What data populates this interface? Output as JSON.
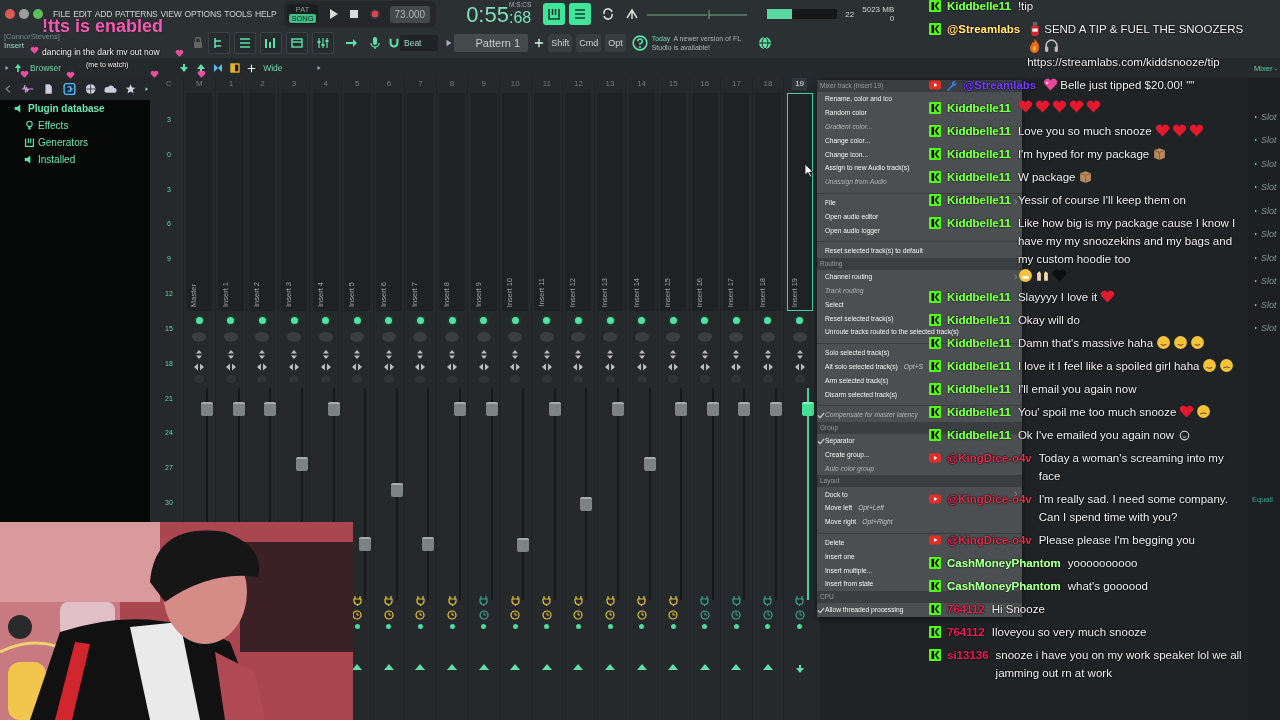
{
  "menu_bar": [
    "FILE",
    "EDIT",
    "ADD",
    "PATTERNS",
    "VIEW",
    "OPTIONS",
    "TOOLS",
    "HELP"
  ],
  "transport": {
    "modes": [
      {
        "label": "PAT",
        "selected": false
      },
      {
        "label": "SONG",
        "selected": true
      }
    ],
    "tempo": "73.000",
    "time": "0:55",
    "time_fraction": ":68",
    "time_unit": "M:S:CS"
  },
  "cpu_meter": {
    "level": 0.35
  },
  "cpu": "22",
  "memory": "5023 MB",
  "polyphony": "0",
  "toolbar": {
    "user_tag": "[ConnorStevens]",
    "track_label": "Insert",
    "snap": "Beat",
    "pattern": "Pattern 1",
    "modifiers": [
      "Shift",
      "Cmd",
      "Opt"
    ],
    "news_date": "Today",
    "news": "A newer version of FL Studio is available!"
  },
  "browser_bar": {
    "title": "Browser",
    "view": "Wide",
    "mixer_title": "Mixer -"
  },
  "browser": {
    "tree": [
      {
        "label": "Plugin database",
        "kind": "database",
        "children": [
          {
            "label": "Effects",
            "kind": "effects"
          },
          {
            "label": "Generators",
            "kind": "generators"
          },
          {
            "label": "Installed",
            "kind": "installed"
          }
        ]
      }
    ]
  },
  "mixer": {
    "scale_header": "C",
    "scale": [
      "3",
      "0",
      "3",
      "6",
      "9",
      "12",
      "15",
      "18",
      "21",
      "24",
      "27",
      "30"
    ],
    "tracks": [
      {
        "number": "M",
        "name": "Master",
        "level": 0.93,
        "selected": false
      },
      {
        "number": "1",
        "name": "Insert 1",
        "level": 0.93,
        "selected": false
      },
      {
        "number": "2",
        "name": "Insert 2",
        "level": 0.93,
        "selected": false
      },
      {
        "number": "3",
        "name": "Insert 3",
        "level": 0.65,
        "selected": false
      },
      {
        "number": "4",
        "name": "Insert 4",
        "level": 0.93,
        "selected": false
      },
      {
        "number": "5",
        "name": "Insert 5",
        "level": 0.25,
        "selected": false,
        "fx": true
      },
      {
        "number": "6",
        "name": "Insert 6",
        "level": 0.52,
        "selected": false,
        "fx": true
      },
      {
        "number": "7",
        "name": "Insert 7",
        "level": 0.25,
        "selected": false,
        "fx": true
      },
      {
        "number": "8",
        "name": "Insert 8",
        "level": 0.93,
        "selected": false,
        "fx": true
      },
      {
        "number": "9",
        "name": "Insert 9",
        "level": 0.93,
        "selected": false,
        "fx": false
      },
      {
        "number": "10",
        "name": "Insert 10",
        "level": 0.24,
        "selected": false,
        "fx": true
      },
      {
        "number": "11",
        "name": "Insert 11",
        "level": 0.93,
        "selected": false,
        "fx": true
      },
      {
        "number": "12",
        "name": "Insert 12",
        "level": 0.45,
        "selected": false,
        "fx": true
      },
      {
        "number": "13",
        "name": "Insert 13",
        "level": 0.93,
        "selected": false,
        "fx": true
      },
      {
        "number": "14",
        "name": "Insert 14",
        "level": 0.65,
        "selected": false,
        "fx": true
      },
      {
        "number": "15",
        "name": "Insert 15",
        "level": 0.93,
        "selected": false,
        "fx": true
      },
      {
        "number": "16",
        "name": "Insert 16",
        "level": 0.93,
        "selected": false,
        "fx": false
      },
      {
        "number": "17",
        "name": "Insert 17",
        "level": 0.93,
        "selected": false,
        "fx": false
      },
      {
        "number": "18",
        "name": "Insert 18",
        "level": 0.93,
        "selected": false,
        "fx": false
      },
      {
        "number": "19",
        "name": "Insert 19",
        "level": 0.93,
        "selected": true,
        "fx": false
      }
    ]
  },
  "right_panel": {
    "slots": [
      "Slot",
      "Slot",
      "Slot",
      "Slot",
      "Slot",
      "Slot",
      "Slot",
      "Slot",
      "Slot",
      "Slot"
    ],
    "label": "Equali"
  },
  "context_menu": {
    "title": "Mixer track (Insert 19)",
    "items": [
      {
        "kind": "item",
        "label": "Rename, color and ico",
        "disabled": false,
        "checked": false,
        "submenu": false
      },
      {
        "kind": "item",
        "label": "Random color",
        "disabled": false,
        "checked": false,
        "submenu": false
      },
      {
        "kind": "item",
        "label": "Gradient color...",
        "disabled": true,
        "checked": false,
        "submenu": false
      },
      {
        "kind": "item",
        "label": "Change color...",
        "disabled": false,
        "checked": false,
        "submenu": false
      },
      {
        "kind": "item",
        "label": "Change icon...",
        "disabled": false,
        "checked": false,
        "submenu": false
      },
      {
        "kind": "item",
        "label": "Assign to new Audio track(s)",
        "disabled": false,
        "checked": false,
        "submenu": false
      },
      {
        "kind": "item",
        "label": "Unassign from Audio",
        "disabled": true,
        "checked": false,
        "submenu": false
      },
      {
        "kind": "separator"
      },
      {
        "kind": "item",
        "label": "File",
        "disabled": false,
        "checked": false,
        "submenu": true
      },
      {
        "kind": "item",
        "label": "Open audio editor",
        "disabled": false,
        "checked": false,
        "submenu": false
      },
      {
        "kind": "item",
        "label": "Open audio logger",
        "disabled": false,
        "checked": false,
        "submenu": false
      },
      {
        "kind": "separator"
      },
      {
        "kind": "item",
        "label": "Reset selected track(s) to default",
        "disabled": false,
        "checked": false,
        "submenu": false
      },
      {
        "kind": "header",
        "label": "Routing"
      },
      {
        "kind": "item",
        "label": "Channel routing",
        "disabled": false,
        "checked": false,
        "submenu": true
      },
      {
        "kind": "item",
        "label": "Track routing",
        "disabled": true,
        "checked": false,
        "submenu": false
      },
      {
        "kind": "item",
        "label": "Select",
        "disabled": false,
        "checked": false,
        "submenu": false
      },
      {
        "kind": "item",
        "label": "Reset selected track(s)",
        "disabled": false,
        "checked": false,
        "submenu": false
      },
      {
        "kind": "item",
        "label": "Unroute tracks routed to the selected track(s)",
        "disabled": false,
        "checked": false,
        "submenu": false
      },
      {
        "kind": "separator"
      },
      {
        "kind": "item",
        "label": "Solo selected track(s)",
        "disabled": false,
        "checked": false,
        "submenu": false
      },
      {
        "kind": "item",
        "label": "Alt solo selected track(s)",
        "disabled": false,
        "checked": false,
        "submenu": false,
        "shortcut": "Opt+S"
      },
      {
        "kind": "item",
        "label": "Arm selected track(s)",
        "disabled": false,
        "checked": false,
        "submenu": false
      },
      {
        "kind": "item",
        "label": "Disarm selected track(s)",
        "disabled": false,
        "checked": false,
        "submenu": false
      },
      {
        "kind": "separator"
      },
      {
        "kind": "item",
        "label": "Compensate for master latency",
        "disabled": true,
        "checked": true,
        "submenu": false
      },
      {
        "kind": "header",
        "label": "Group"
      },
      {
        "kind": "item",
        "label": "Separator",
        "disabled": false,
        "checked": true,
        "submenu": false
      },
      {
        "kind": "item",
        "label": "Create group...",
        "disabled": false,
        "checked": false,
        "submenu": false
      },
      {
        "kind": "item",
        "label": "Auto color group",
        "disabled": true,
        "checked": false,
        "submenu": false
      },
      {
        "kind": "header",
        "label": "Layout"
      },
      {
        "kind": "item",
        "label": "Dock to",
        "disabled": false,
        "checked": false,
        "submenu": true
      },
      {
        "kind": "item",
        "label": "Move left",
        "disabled": false,
        "checked": false,
        "submenu": false,
        "shortcut": "Opt+Left"
      },
      {
        "kind": "item",
        "label": "Move right",
        "disabled": false,
        "checked": false,
        "submenu": false,
        "shortcut": "Opt+Right"
      },
      {
        "kind": "separator"
      },
      {
        "kind": "item",
        "label": "Delete",
        "disabled": false,
        "checked": false,
        "submenu": false
      },
      {
        "kind": "item",
        "label": "Insert one",
        "disabled": false,
        "checked": false,
        "submenu": false
      },
      {
        "kind": "item",
        "label": "Insert multiple...",
        "disabled": false,
        "checked": false,
        "submenu": false
      },
      {
        "kind": "item",
        "label": "Insert from state",
        "disabled": false,
        "checked": false,
        "submenu": false
      },
      {
        "kind": "header",
        "label": "CPU"
      },
      {
        "kind": "item",
        "label": "Allow threaded processing",
        "disabled": false,
        "checked": true,
        "submenu": false
      }
    ]
  },
  "stream_overlay": {
    "alert": "!tts is enabled",
    "now_playing": "dancing in the dark mv out now",
    "note": "(me to watch)"
  },
  "chat": [
    {
      "badges": [
        {
          "kind": "kick"
        }
      ],
      "user": "Kiddbelle11",
      "color": "#62ec3a",
      "content": [
        {
          "kind": "text",
          "text": "!tip"
        }
      ]
    },
    {
      "badges": [
        {
          "kind": "kick"
        }
      ],
      "user": "@Streamlabs",
      "color": "#e6b45a",
      "content": [
        {
          "kind": "extinguisher"
        },
        {
          "kind": "text",
          "text": "SEND A TIP & FUEL THE SNOOZERS"
        },
        {
          "kind": "fire"
        },
        {
          "kind": "headphones"
        },
        {
          "kind": "text",
          "text": "https://streamlabs.com/kiddsnooze/tip"
        }
      ]
    },
    {
      "badges": [
        {
          "kind": "youtube"
        },
        {
          "kind": "wrench"
        }
      ],
      "user": "@Streamlabs",
      "color": "#5a2fd0",
      "content": [
        {
          "kind": "sparkle_heart"
        },
        {
          "kind": "text",
          "text": "Belle just tipped $20.00! \"\""
        }
      ]
    },
    {
      "badges": [
        {
          "kind": "kick"
        }
      ],
      "user": "Kiddbelle11",
      "color": "#62ec3a",
      "content": [
        {
          "kind": "heart"
        },
        {
          "kind": "heart"
        },
        {
          "kind": "heart"
        },
        {
          "kind": "heart"
        },
        {
          "kind": "heart"
        }
      ]
    },
    {
      "badges": [
        {
          "kind": "kick"
        }
      ],
      "user": "Kiddbelle11",
      "color": "#62ec3a",
      "content": [
        {
          "kind": "text",
          "text": "Love you so much snooze"
        },
        {
          "kind": "heart"
        },
        {
          "kind": "heart"
        },
        {
          "kind": "heart"
        }
      ]
    },
    {
      "badges": [
        {
          "kind": "kick"
        }
      ],
      "user": "Kiddbelle11",
      "color": "#62ec3a",
      "content": [
        {
          "kind": "text",
          "text": "I'm hyped for my package"
        },
        {
          "kind": "package"
        }
      ]
    },
    {
      "badges": [
        {
          "kind": "kick"
        }
      ],
      "user": "Kiddbelle11",
      "color": "#62ec3a",
      "content": [
        {
          "kind": "text",
          "text": "W package"
        },
        {
          "kind": "package"
        }
      ]
    },
    {
      "badges": [
        {
          "kind": "kick"
        }
      ],
      "user": "Kiddbelle11",
      "color": "#62ec3a",
      "content": [
        {
          "kind": "text",
          "text": "Yessir of course I'll keep them on"
        }
      ]
    },
    {
      "badges": [
        {
          "kind": "kick"
        }
      ],
      "user": "Kiddbelle11",
      "color": "#62ec3a",
      "content": [
        {
          "kind": "text",
          "text": "Like how big is my package cause I know I have my my snoozekins and my bags and my custom hoodie too"
        },
        {
          "kind": "grin"
        },
        {
          "kind": "raised_hands"
        },
        {
          "kind": "black_heart"
        }
      ]
    },
    {
      "badges": [
        {
          "kind": "kick"
        }
      ],
      "user": "Kiddbelle11",
      "color": "#62ec3a",
      "content": [
        {
          "kind": "text",
          "text": "Slayyyy I love it"
        },
        {
          "kind": "heart"
        }
      ]
    },
    {
      "badges": [
        {
          "kind": "kick"
        }
      ],
      "user": "Kiddbelle11",
      "color": "#62ec3a",
      "content": [
        {
          "kind": "text",
          "text": "Okay will do"
        }
      ]
    },
    {
      "badges": [
        {
          "kind": "kick"
        }
      ],
      "user": "Kiddbelle11",
      "color": "#62ec3a",
      "content": [
        {
          "kind": "text",
          "text": "Damn that's massive haha"
        },
        {
          "kind": "smile"
        },
        {
          "kind": "smile"
        },
        {
          "kind": "smile"
        }
      ]
    },
    {
      "badges": [
        {
          "kind": "kick"
        }
      ],
      "user": "Kiddbelle11",
      "color": "#62ec3a",
      "content": [
        {
          "kind": "text",
          "text": "I love it I feel like a spoiled girl haha"
        },
        {
          "kind": "smile"
        },
        {
          "kind": "woozy"
        }
      ]
    },
    {
      "badges": [
        {
          "kind": "kick"
        }
      ],
      "user": "Kiddbelle11",
      "color": "#62ec3a",
      "content": [
        {
          "kind": "text",
          "text": "I'll email you again now"
        }
      ]
    },
    {
      "badges": [
        {
          "kind": "kick"
        }
      ],
      "user": "Kiddbelle11",
      "color": "#62ec3a",
      "content": [
        {
          "kind": "text",
          "text": "You' spoil me too much snooze"
        },
        {
          "kind": "heart"
        },
        {
          "kind": "woozy"
        }
      ]
    },
    {
      "badges": [
        {
          "kind": "kick"
        }
      ],
      "user": "Kiddbelle11",
      "color": "#62ec3a",
      "content": [
        {
          "kind": "text",
          "text": "Ok I've emailed you again now"
        },
        {
          "kind": "small_smile"
        }
      ]
    },
    {
      "badges": [
        {
          "kind": "youtube"
        }
      ],
      "user": "@KingDice-o4v",
      "color": "#a3243a",
      "content": [
        {
          "kind": "text",
          "text": "Today a woman's screaming into my face"
        }
      ]
    },
    {
      "badges": [
        {
          "kind": "youtube"
        }
      ],
      "user": "@KingDice-o4v",
      "color": "#a3243a",
      "content": [
        {
          "kind": "text",
          "text": "I'm really sad. I need some company. Can I spend time with you?"
        }
      ]
    },
    {
      "badges": [
        {
          "kind": "youtube"
        }
      ],
      "user": "@KingDice-o4v",
      "color": "#a3243a",
      "content": [
        {
          "kind": "text",
          "text": "Please please I'm begging you"
        }
      ]
    },
    {
      "badges": [
        {
          "kind": "kick"
        }
      ],
      "user": "CashMoneyPhantom",
      "color": "#86ee74",
      "content": [
        {
          "kind": "text",
          "text": "yoooooooooo"
        }
      ]
    },
    {
      "badges": [
        {
          "kind": "kick"
        }
      ],
      "user": "CashMoneyPhantom",
      "color": "#86ee74",
      "content": [
        {
          "kind": "text",
          "text": "what's goooood"
        }
      ]
    },
    {
      "badges": [
        {
          "kind": "kick"
        }
      ],
      "user": "764112",
      "color": "#b0183f",
      "content": [
        {
          "kind": "text",
          "text": "Hi Snooze"
        }
      ]
    },
    {
      "badges": [
        {
          "kind": "kick"
        }
      ],
      "user": "764112",
      "color": "#b0183f",
      "content": [
        {
          "kind": "text",
          "text": "Iloveyou so very much snooze"
        }
      ]
    },
    {
      "badges": [
        {
          "kind": "kick"
        }
      ],
      "user": "si13136",
      "color": "#b0183f",
      "content": [
        {
          "kind": "text",
          "text": "snooze i have you on my work speaker lol we all jamming out rn at work"
        }
      ]
    }
  ]
}
